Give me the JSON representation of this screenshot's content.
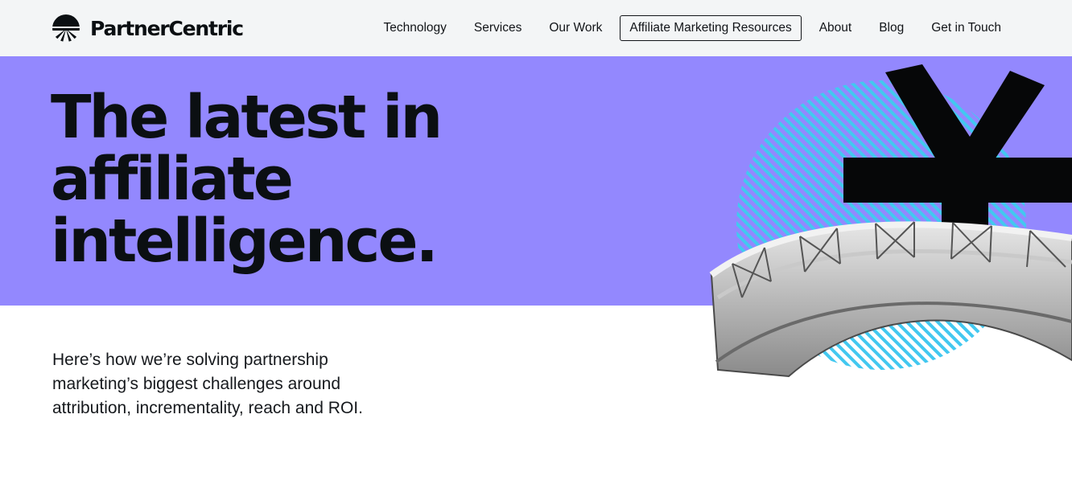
{
  "brand": {
    "name": "PartnerCentric",
    "logo_icon": "partnercentric-sun-logo-icon"
  },
  "nav": {
    "items": [
      {
        "label": "Technology"
      },
      {
        "label": "Services"
      },
      {
        "label": "Our Work"
      },
      {
        "label": "Affiliate Marketing Resources",
        "active": true
      },
      {
        "label": "About"
      },
      {
        "label": "Blog"
      },
      {
        "label": "Get in Touch"
      }
    ]
  },
  "hero": {
    "title": "The latest in affiliate intelligence.",
    "subtitle": "Here’s how we’re solving partnership marketing’s biggest challenges around attribution, incrementality, reach and ROI.",
    "illustration": "yen-symbol-bridge-illustration"
  },
  "colors": {
    "header_bg": "#f3f5f6",
    "hero_band": "#9388fe",
    "text": "#0b0f12",
    "stripe_accent": "#42c8f0"
  }
}
